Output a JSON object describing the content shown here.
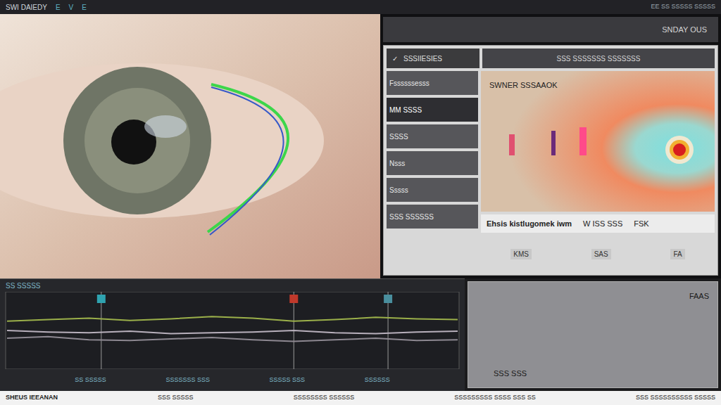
{
  "top_bar": {
    "title": "SWI DAIEDY",
    "glyphs": [
      "E",
      "V",
      "E"
    ],
    "right_text": "EE SS SSSSS SSSSS"
  },
  "header": {
    "label": "SNDAY OUS"
  },
  "panel": {
    "confirm_button": {
      "icon": "✓",
      "label": "SSSIIESIES"
    },
    "title_bar": "SSS SSSSSSS SSSSSSS"
  },
  "sidebar": {
    "items": [
      {
        "label": "Fssssssesss",
        "selected": false
      },
      {
        "label": "MM SSSS",
        "selected": true
      },
      {
        "label": "SSSS",
        "selected": false
      },
      {
        "label": "Nsss",
        "selected": false
      },
      {
        "label": "Sssss",
        "selected": false
      },
      {
        "label": "SSS SSSSSS",
        "selected": false
      }
    ]
  },
  "heatmap": {
    "title": "SWNER SSSAAOK"
  },
  "caption": {
    "texts": [
      "Ehsis kistlugomek iwm",
      "W ISS SSS",
      "FSK"
    ]
  },
  "readouts": [
    "KMS",
    "SAS",
    "FA"
  ],
  "chart": {
    "title": "SS SSSSS",
    "series": [
      {
        "values": [
          62,
          64,
          66,
          63,
          65,
          68,
          66,
          62,
          64,
          67,
          65,
          64
        ],
        "color": "#9bb04a"
      },
      {
        "values": [
          50,
          48,
          47,
          49,
          46,
          47,
          48,
          50,
          47,
          46,
          48,
          49
        ],
        "color": "#b8b0bc"
      },
      {
        "values": [
          40,
          42,
          38,
          37,
          39,
          41,
          38,
          36,
          38,
          40,
          37,
          38
        ],
        "color": "#8d8891"
      }
    ],
    "markers": [
      {
        "at": 2.3,
        "color": "#2fa3b0"
      },
      {
        "at": 7,
        "color": "#c0392b"
      },
      {
        "at": 9.3,
        "color": "#4a8f9e"
      }
    ],
    "labels": [
      "SS SSSSS",
      "SSSSSSS SSS",
      "SSSSS SSS",
      "SSSSSS"
    ]
  },
  "side_panel": {
    "texts": [
      "SSS SSS",
      "FAAS"
    ]
  },
  "status_bar": {
    "items": [
      "SHEUS IEEANAN",
      "SSS SSSSS",
      "SSSSSSSS SSSSSS",
      "SSSSSSSSS SSSS SSS SS",
      "SSS SSSSSSSSSS SSSSS"
    ]
  }
}
